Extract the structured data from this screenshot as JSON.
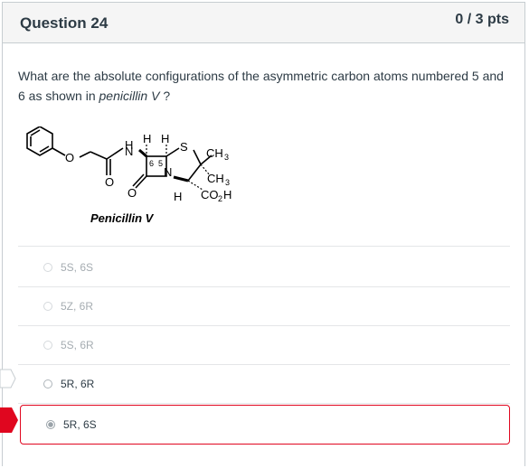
{
  "question": {
    "title": "Question 24",
    "points": "0 / 3 pts",
    "text_before": "What are the absolute configurations of the asymmetric carbon atoms numbered 5 and 6 as shown in ",
    "text_italic": "penicillin V",
    "text_after": " ?"
  },
  "structure": {
    "compound_name": "Penicillin V",
    "atom_labels": [
      "H",
      "H",
      "H",
      "N",
      "S",
      "CH3",
      "6",
      "5",
      "N",
      "CH3",
      "H",
      "CO2H",
      "O",
      "O",
      "O"
    ]
  },
  "answers": [
    {
      "label": "5S, 6S",
      "state": "dim"
    },
    {
      "label": "5Z, 6R",
      "state": "dim"
    },
    {
      "label": "5S, 6R",
      "state": "dim"
    },
    {
      "label": "5R, 6R",
      "state": "normal"
    },
    {
      "label": "5R, 6S",
      "state": "selected"
    }
  ],
  "colors": {
    "header_bg": "#f5f5f5",
    "border": "#c7cdd1",
    "incorrect_red": "#e0061f",
    "text": "#2d3b45"
  }
}
